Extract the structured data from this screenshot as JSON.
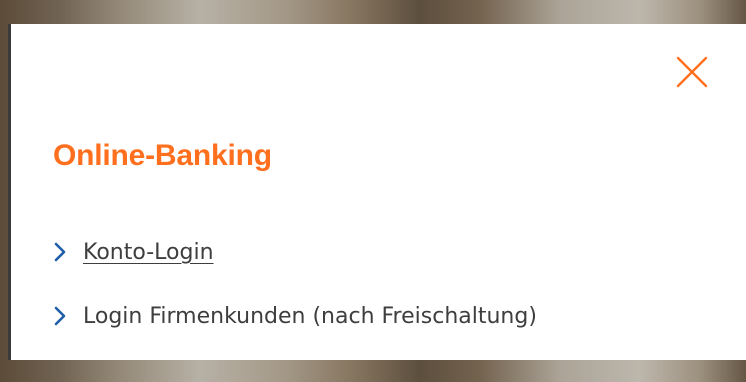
{
  "dialog": {
    "title": "Online-Banking",
    "close_icon": "close-icon",
    "accent_color": "#ff6f1d",
    "link_icon_color": "#1f5fa8",
    "links": [
      {
        "label": "Konto-Login",
        "icon": "chevron-right-icon"
      },
      {
        "label": "Login Firmenkunden (nach Freischaltung)",
        "icon": "chevron-right-icon"
      }
    ]
  }
}
